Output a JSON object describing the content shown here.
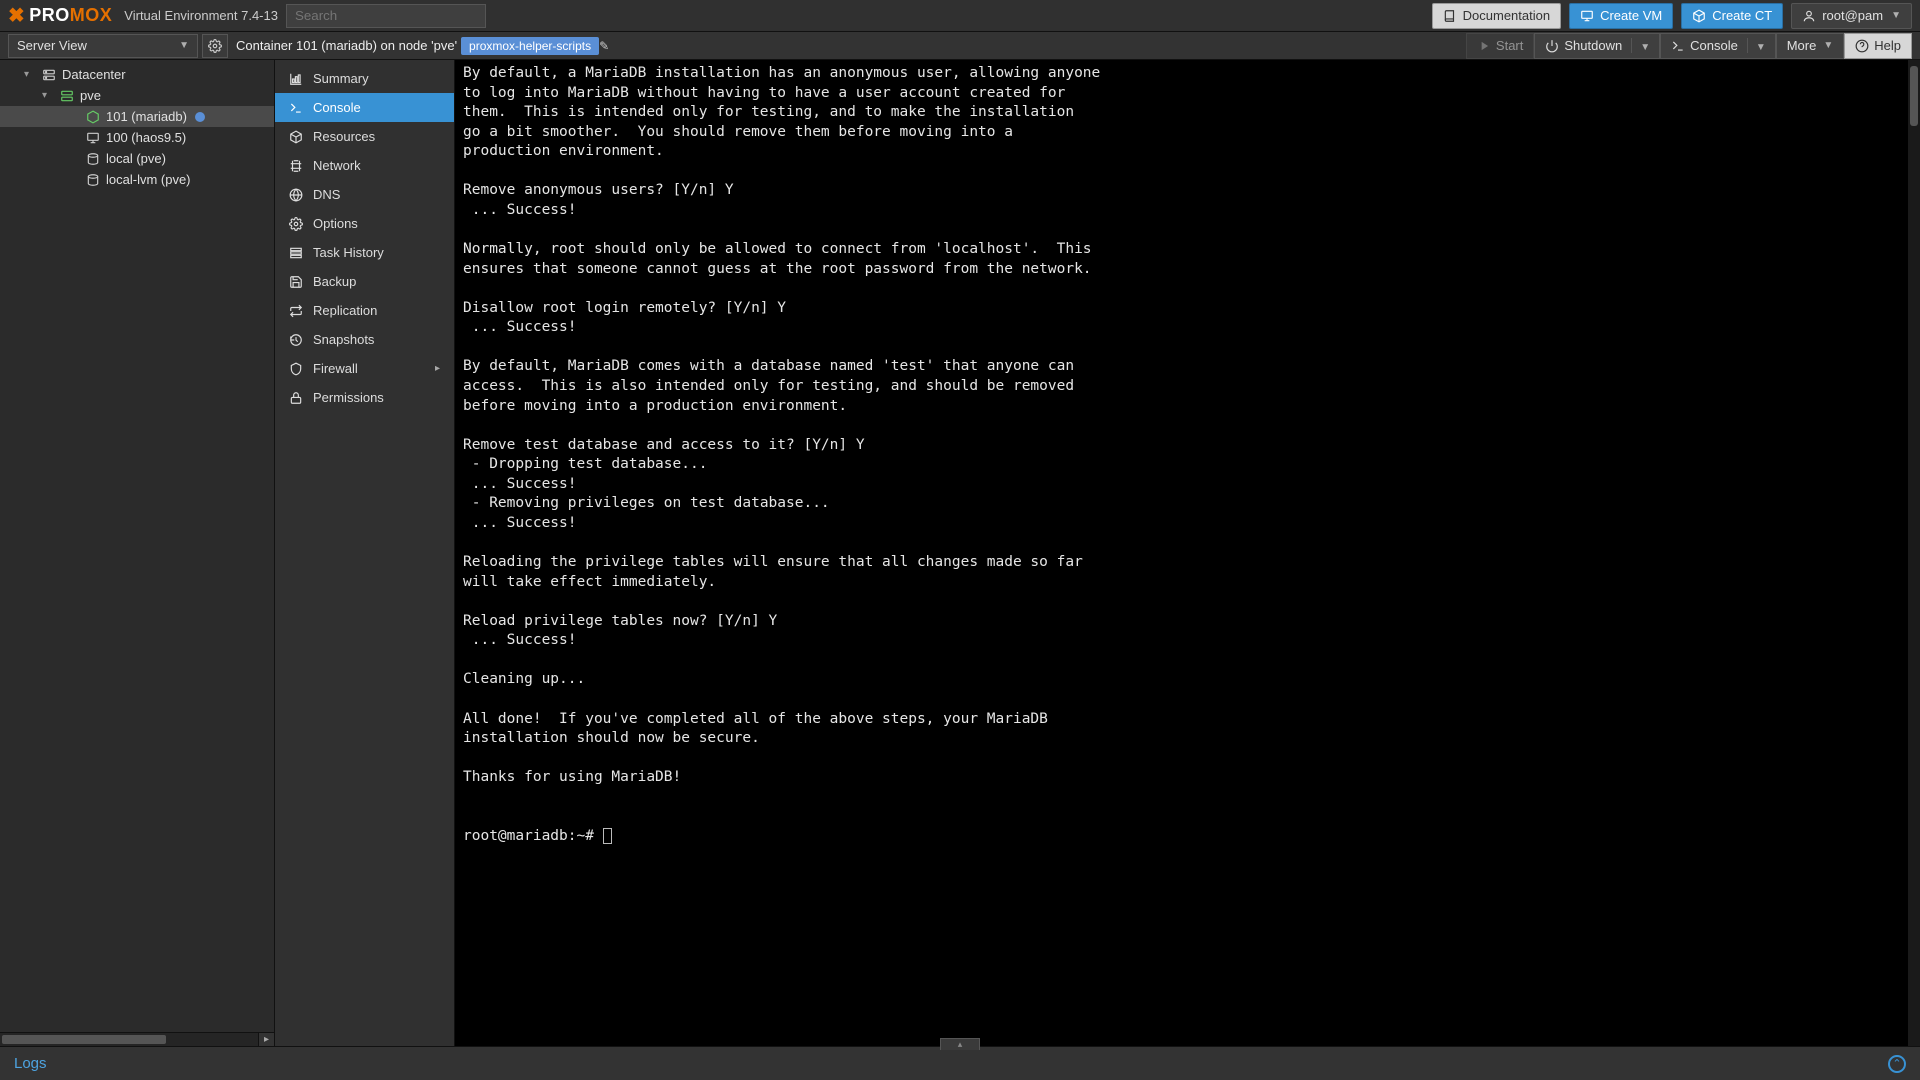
{
  "header": {
    "brand_pro": "PRO",
    "brand_mox": "MOX",
    "version": "Virtual Environment 7.4-13",
    "search_placeholder": "Search",
    "documentation": "Documentation",
    "create_vm": "Create VM",
    "create_ct": "Create CT",
    "user": "root@pam"
  },
  "tree": {
    "view_label": "Server View",
    "nodes": [
      {
        "label": "Datacenter",
        "icon": "server-icon",
        "depth": 1,
        "expand": "▾"
      },
      {
        "label": "pve",
        "icon": "node-icon",
        "depth": 2,
        "expand": "▾"
      },
      {
        "label": "101 (mariadb)",
        "icon": "lxc-icon",
        "depth": 3,
        "selected": true,
        "dot": true
      },
      {
        "label": "100 (haos9.5)",
        "icon": "vm-icon",
        "depth": 3
      },
      {
        "label": "local (pve)",
        "icon": "storage-icon",
        "depth": 3
      },
      {
        "label": "local-lvm (pve)",
        "icon": "storage-icon",
        "depth": 3
      }
    ]
  },
  "breadcrumb": {
    "text": "Container 101 (mariadb) on node 'pve'",
    "tag": "proxmox-helper-scripts"
  },
  "actions": {
    "start": "Start",
    "shutdown": "Shutdown",
    "console": "Console",
    "more": "More",
    "help": "Help"
  },
  "sidemenu": [
    {
      "label": "Summary",
      "icon": "chart-icon"
    },
    {
      "label": "Console",
      "icon": "terminal-icon",
      "active": true
    },
    {
      "label": "Resources",
      "icon": "cube-icon"
    },
    {
      "label": "Network",
      "icon": "net-icon"
    },
    {
      "label": "DNS",
      "icon": "globe-icon"
    },
    {
      "label": "Options",
      "icon": "gear-icon"
    },
    {
      "label": "Task History",
      "icon": "list-icon"
    },
    {
      "label": "Backup",
      "icon": "save-icon"
    },
    {
      "label": "Replication",
      "icon": "replicate-icon"
    },
    {
      "label": "Snapshots",
      "icon": "history-icon"
    },
    {
      "label": "Firewall",
      "icon": "shield-icon",
      "caret": true
    },
    {
      "label": "Permissions",
      "icon": "lock-icon"
    }
  ],
  "console_lines": [
    "By default, a MariaDB installation has an anonymous user, allowing anyone",
    "to log into MariaDB without having to have a user account created for",
    "them.  This is intended only for testing, and to make the installation",
    "go a bit smoother.  You should remove them before moving into a",
    "production environment.",
    "",
    "Remove anonymous users? [Y/n] Y",
    " ... Success!",
    "",
    "Normally, root should only be allowed to connect from 'localhost'.  This",
    "ensures that someone cannot guess at the root password from the network.",
    "",
    "Disallow root login remotely? [Y/n] Y",
    " ... Success!",
    "",
    "By default, MariaDB comes with a database named 'test' that anyone can",
    "access.  This is also intended only for testing, and should be removed",
    "before moving into a production environment.",
    "",
    "Remove test database and access to it? [Y/n] Y",
    " - Dropping test database...",
    " ... Success!",
    " - Removing privileges on test database...",
    " ... Success!",
    "",
    "Reloading the privilege tables will ensure that all changes made so far",
    "will take effect immediately.",
    "",
    "Reload privilege tables now? [Y/n] Y",
    " ... Success!",
    "",
    "Cleaning up...",
    "",
    "All done!  If you've completed all of the above steps, your MariaDB",
    "installation should now be secure.",
    "",
    "Thanks for using MariaDB!"
  ],
  "console_prompt": "root@mariadb:~# ",
  "bottom": {
    "logs": "Logs"
  }
}
